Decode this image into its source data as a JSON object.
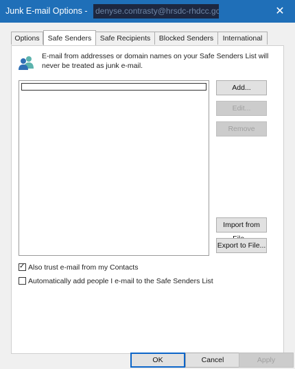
{
  "window": {
    "title": "Junk E-mail Options -",
    "account": "denyse.contrasty@hrsdc-rhdcc.gc.ca",
    "close_glyph": "✕"
  },
  "tabs": [
    {
      "label": "Options"
    },
    {
      "label": "Safe Senders"
    },
    {
      "label": "Safe Recipients"
    },
    {
      "label": "Blocked Senders"
    },
    {
      "label": "International"
    }
  ],
  "panel": {
    "icon": "contacts-icon",
    "description": "E-mail from addresses or domain names on your Safe Senders List will never be treated as junk e-mail.",
    "buttons": {
      "add": "Add...",
      "edit": "Edit...",
      "remove": "Remove",
      "import": "Import from File...",
      "export": "Export to File..."
    },
    "trust_contacts": {
      "label": "Also trust e-mail from my Contacts",
      "checked": true,
      "mark": "✓"
    },
    "auto_add": {
      "label": "Automatically add people I e-mail to the Safe Senders List",
      "checked": false
    }
  },
  "footer": {
    "ok": "OK",
    "cancel": "Cancel",
    "apply": "Apply"
  },
  "colors": {
    "titlebar": "#1f6fb8",
    "accent": "#0a64c8"
  }
}
